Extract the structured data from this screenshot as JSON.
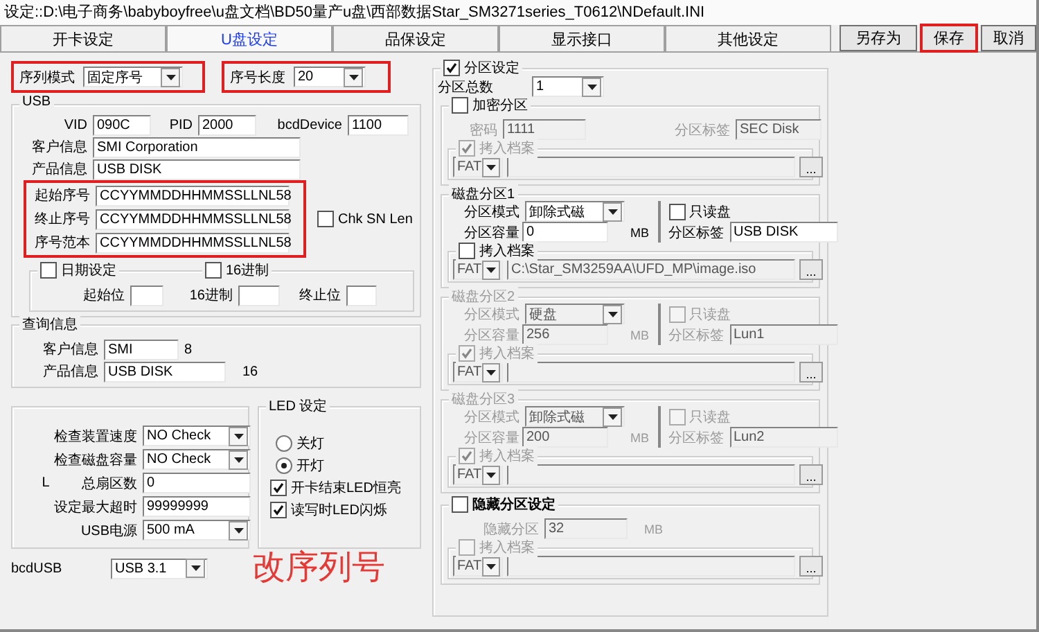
{
  "window": {
    "title": "设定::D:\\电子商务\\babyboyfree\\u盘文档\\BD50量产u盘\\西部数据Star_SM3271series_T0612\\NDefault.INI"
  },
  "tabs": [
    {
      "label": "开卡设定",
      "selected": false
    },
    {
      "label": "U盘设定",
      "selected": true
    },
    {
      "label": "品保设定",
      "selected": false
    },
    {
      "label": "显示接口",
      "selected": false
    },
    {
      "label": "其他设定",
      "selected": false
    }
  ],
  "buttons": [
    {
      "label": "另存为",
      "highlighted": false
    },
    {
      "label": "保存",
      "highlighted": true
    },
    {
      "label": "取消",
      "highlighted": false
    }
  ],
  "serial_mode": {
    "label": "序列模式",
    "value": "固定序号",
    "highlighted": true
  },
  "serial_length": {
    "label": "序号长度",
    "value": "20",
    "highlighted": true
  },
  "usb": {
    "title": "USB",
    "vid": {
      "label": "VID",
      "value": "090C"
    },
    "pid": {
      "label": "PID",
      "value": "2000"
    },
    "bcd_device": {
      "label": "bcdDevice",
      "value": "1100"
    },
    "customer": {
      "label": "客户信息",
      "value": "SMI Corporation"
    },
    "product": {
      "label": "产品信息",
      "value": "USB DISK"
    },
    "serials": {
      "highlighted": true,
      "rows": [
        {
          "label": "起始序号",
          "value": "CCYYMMDDHHMMSSLLNL58"
        },
        {
          "label": "终止序号",
          "value": "CCYYMMDDHHMMSSLLNL58"
        },
        {
          "label": "序号范本",
          "value": "CCYYMMDDHHMMSSLLNL58"
        }
      ]
    },
    "chk_sn_len": {
      "label": "Chk SN Len",
      "checked": false
    },
    "date": {
      "label": "日期设定",
      "checked": false
    },
    "hex": {
      "label": "16进制",
      "checked": false
    },
    "start_bit": {
      "label": "起始位"
    },
    "hex_field": {
      "label": "16进制"
    },
    "end_bit": {
      "label": "终止位"
    }
  },
  "query": {
    "title": "查询信息",
    "rows": [
      {
        "label": "客户信息",
        "value": "SMI",
        "count": "8"
      },
      {
        "label": "产品信息",
        "value": "USB DISK",
        "count": "16"
      }
    ]
  },
  "checks": {
    "rows": [
      {
        "kind": "select",
        "label": "检查装置速度",
        "value": "NO Check"
      },
      {
        "kind": "select",
        "label": "检查磁盘容量",
        "value": "NO Check"
      },
      {
        "kind": "input",
        "label": "总扇区数",
        "value": "0",
        "note": "L"
      },
      {
        "kind": "input",
        "label": "设定最大超时",
        "value": "99999999"
      },
      {
        "kind": "select",
        "label": "USB电源",
        "value": "500 mA"
      }
    ]
  },
  "led": {
    "title": "LED 设定",
    "radios": [
      {
        "label": "关灯",
        "selected": false
      },
      {
        "label": "开灯",
        "selected": true
      }
    ],
    "checkboxes": [
      {
        "label": "开卡结束LED恒亮",
        "checked": true
      },
      {
        "label": "读写时LED闪烁",
        "checked": true
      }
    ]
  },
  "bcd_usb": {
    "label": "bcdUSB",
    "value": "USB 3.1"
  },
  "annotation": "改序列号",
  "partition": {
    "label": "分区设定",
    "checked": true,
    "count": {
      "label": "分区总数",
      "value": "1"
    },
    "sections": [
      {
        "kind": "encrypted",
        "title": "加密分区",
        "checked": false,
        "disabled": true,
        "password": {
          "label": "密码",
          "value": "1111"
        },
        "tag": {
          "label": "分区标签",
          "value": "SEC Disk"
        },
        "copy": {
          "label": "拷入档案",
          "checked": true,
          "fs": "FAT",
          "browse": "..."
        }
      },
      {
        "kind": "disk",
        "title": "磁盘分区1",
        "disabled": false,
        "mode": {
          "label": "分区模式",
          "value": "卸除式磁"
        },
        "capacity": {
          "label": "分区容量",
          "value": "0",
          "unit": "MB"
        },
        "readonly": {
          "label": "只读盘",
          "checked": false
        },
        "tag": {
          "label": "分区标签",
          "value": "USB DISK"
        },
        "copy": {
          "label": "拷入档案",
          "checked": false,
          "fs": "FAT",
          "path": "C:\\Star_SM3259AA\\UFD_MP\\image.iso",
          "browse": "..."
        }
      },
      {
        "kind": "disk",
        "title": "磁盘分区2",
        "disabled": true,
        "mode": {
          "label": "分区模式",
          "value": "硬盘"
        },
        "capacity": {
          "label": "分区容量",
          "value": "256",
          "unit": "MB"
        },
        "readonly": {
          "label": "只读盘",
          "checked": false
        },
        "tag": {
          "label": "分区标签",
          "value": "Lun1"
        },
        "copy": {
          "label": "拷入档案",
          "checked": true,
          "fs": "FAT",
          "browse": "..."
        }
      },
      {
        "kind": "disk",
        "title": "磁盘分区3",
        "disabled": true,
        "mode": {
          "label": "分区模式",
          "value": "卸除式磁"
        },
        "capacity": {
          "label": "分区容量",
          "value": "200",
          "unit": "MB"
        },
        "readonly": {
          "label": "只读盘",
          "checked": false
        },
        "tag": {
          "label": "分区标签",
          "value": "Lun2"
        },
        "copy": {
          "label": "拷入档案",
          "checked": true,
          "fs": "FAT",
          "browse": "..."
        }
      },
      {
        "kind": "hidden",
        "title": "隐藏分区设定",
        "checked": false,
        "disabled": true,
        "size": {
          "label": "隐藏分区",
          "value": "32",
          "unit": "MB"
        },
        "copy": {
          "label": "拷入档案",
          "checked": false,
          "fs": "FAT",
          "browse": "..."
        }
      }
    ]
  }
}
